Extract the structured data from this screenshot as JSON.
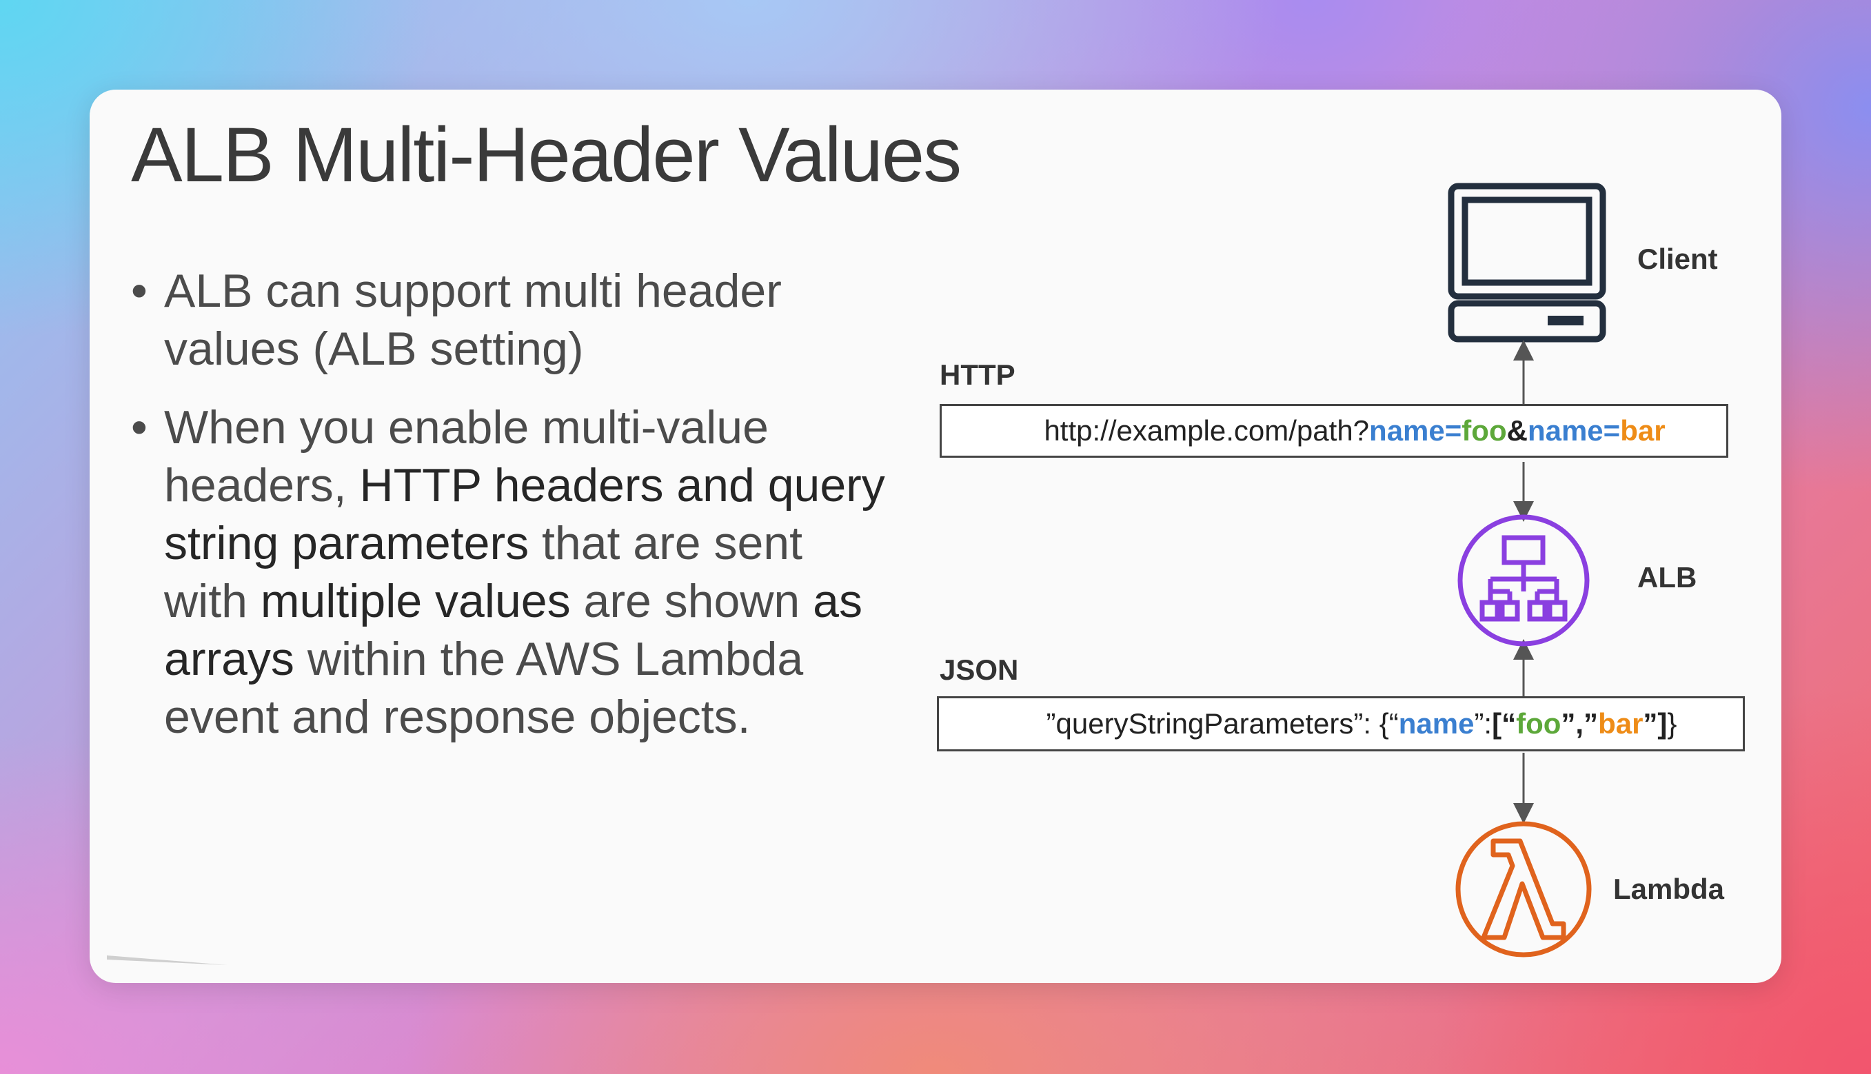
{
  "title": "ALB Multi-Header Values",
  "bullets": [
    {
      "parts": [
        {
          "text": "ALB can support multi header values (ALB setting)",
          "em": false
        }
      ]
    },
    {
      "parts": [
        {
          "text": "When you enable multi-value headers, ",
          "em": false
        },
        {
          "text": "HTTP headers and query string parameters",
          "em": true
        },
        {
          "text": " that are sent with ",
          "em": false
        },
        {
          "text": "multiple values",
          "em": true
        },
        {
          "text": " are shown ",
          "em": false
        },
        {
          "text": "as arrays",
          "em": true
        },
        {
          "text": " within the AWS Lambda event and response objects.",
          "em": false
        }
      ]
    }
  ],
  "diagram": {
    "client_label": "Client",
    "alb_label": "ALB",
    "lambda_label": "Lambda",
    "http_label": "HTTP",
    "json_label": "JSON",
    "url": {
      "prefix": "http://example.com/path?",
      "k1": "name=",
      "v1": "foo",
      "amp": "&",
      "k2": "name=",
      "v2": "bar"
    },
    "json": {
      "open": "”queryStringParameters”: {“",
      "key": "name",
      "mid": "”: ",
      "lbr": "[“",
      "v1": "foo",
      "sep": "”,”",
      "v2": "bar",
      "rbr": "”]",
      "close": " }"
    }
  },
  "colors": {
    "key_blue": "#3a7fd0",
    "val_green": "#5da83a",
    "val_orange": "#ee8c17",
    "alb_purple": "#8a3fe0",
    "lambda_orange": "#e0631d"
  },
  "icons": [
    "client-computer-icon",
    "alb-icon",
    "lambda-icon"
  ]
}
